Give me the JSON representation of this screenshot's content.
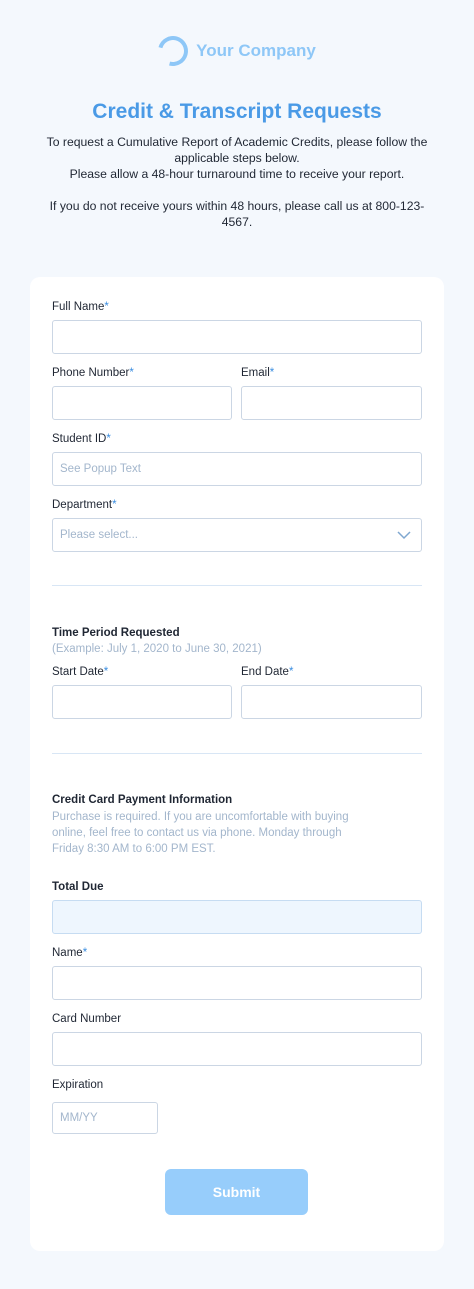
{
  "brand": {
    "name": "Your Company"
  },
  "header": {
    "title": "Credit & Transcript Requests",
    "intro_line1": "To request a Cumulative Report of Academic Credits, please follow the applicable steps below.",
    "intro_line2": "Please allow a 48-hour turnaround time to receive your report.",
    "intro_line3": "If you do not receive yours within 48 hours, please call us at 800-123-4567."
  },
  "form": {
    "required_mark": "*",
    "full_name": {
      "label": "Full Name",
      "value": ""
    },
    "phone": {
      "label": "Phone Number",
      "value": ""
    },
    "email": {
      "label": "Email",
      "value": ""
    },
    "student_id": {
      "label": "Student ID",
      "placeholder": "See Popup Text"
    },
    "department": {
      "label": "Department",
      "placeholder": "Please select..."
    },
    "time_period": {
      "title": "Time Period Requested",
      "help": "(Example: July 1, 2020 to June 30, 2021)",
      "start_label": "Start Date",
      "end_label": "End Date"
    },
    "payment": {
      "title": "Credit Card Payment Information",
      "help": "Purchase is required. If you are uncomfortable with buying online, feel free to contact us via phone. Monday through Friday 8:30 AM to 6:00 PM EST.",
      "total_label": "Total Due",
      "name_label": "Name",
      "card_label": "Card Number",
      "expiration_label": "Expiration",
      "expiration_placeholder": "MM/YY"
    },
    "submit_label": "Submit"
  },
  "colors": {
    "accent": "#4a9ae6",
    "logo": "#8ec7f7",
    "submit": "#97cdfb",
    "background": "#f4f8fd"
  }
}
